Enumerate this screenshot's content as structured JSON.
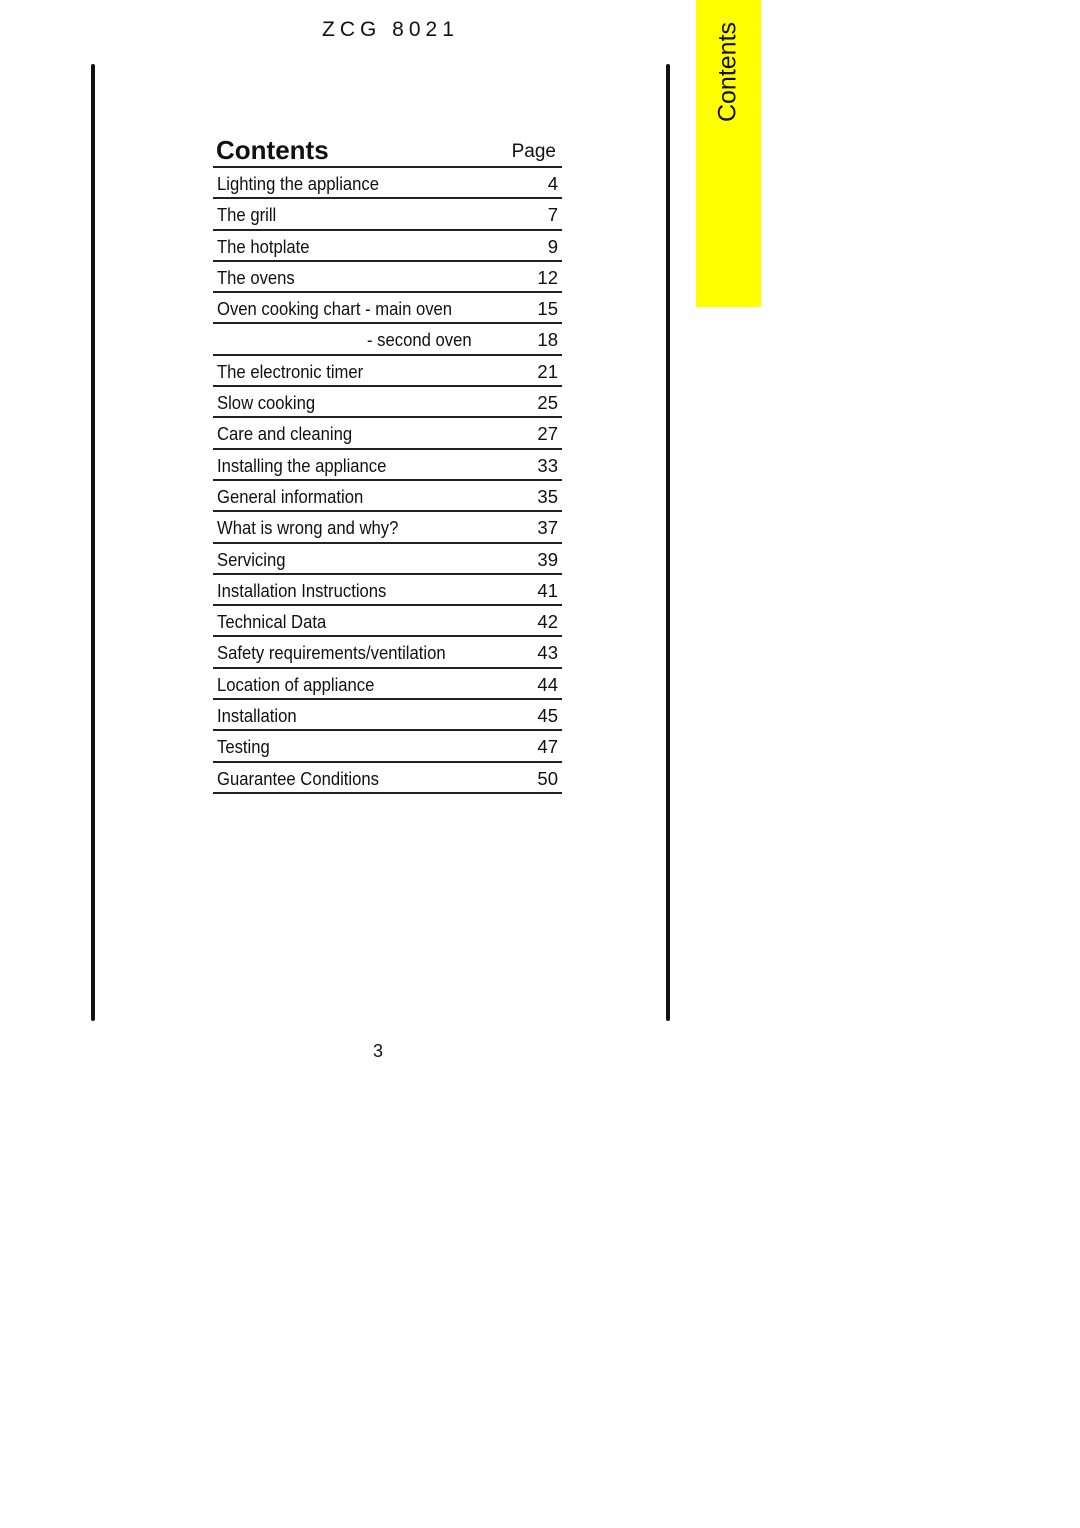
{
  "header": {
    "model": "ZCG 8021"
  },
  "side_tab": {
    "label": "Contents",
    "color": "#ffff00"
  },
  "toc": {
    "title": "Contents",
    "page_header": "Page",
    "entries": [
      {
        "label": "Lighting the appliance",
        "page": "4"
      },
      {
        "label": "The grill",
        "page": "7"
      },
      {
        "label": "The hotplate",
        "page": "9"
      },
      {
        "label": "The ovens",
        "page": "12"
      },
      {
        "label": "Oven cooking chart - main oven",
        "page": "15"
      },
      {
        "label": "- second oven",
        "page": "18",
        "indent": true
      },
      {
        "label": "The electronic timer",
        "page": "21"
      },
      {
        "label": "Slow cooking",
        "page": "25"
      },
      {
        "label": "Care and cleaning",
        "page": "27"
      },
      {
        "label": "Installing the appliance",
        "page": "33"
      },
      {
        "label": "General information",
        "page": "35"
      },
      {
        "label": "What is wrong and why?",
        "page": "37"
      },
      {
        "label": "Servicing",
        "page": "39"
      },
      {
        "label": "Installation Instructions",
        "page": "41"
      },
      {
        "label": "Technical Data",
        "page": "42"
      },
      {
        "label": "Safety requirements/ventilation",
        "page": "43"
      },
      {
        "label": "Location of appliance",
        "page": "44"
      },
      {
        "label": "Installation",
        "page": "45"
      },
      {
        "label": "Testing",
        "page": "47"
      },
      {
        "label": "Guarantee Conditions",
        "page": "50"
      }
    ]
  },
  "footer": {
    "page_number": "3"
  }
}
